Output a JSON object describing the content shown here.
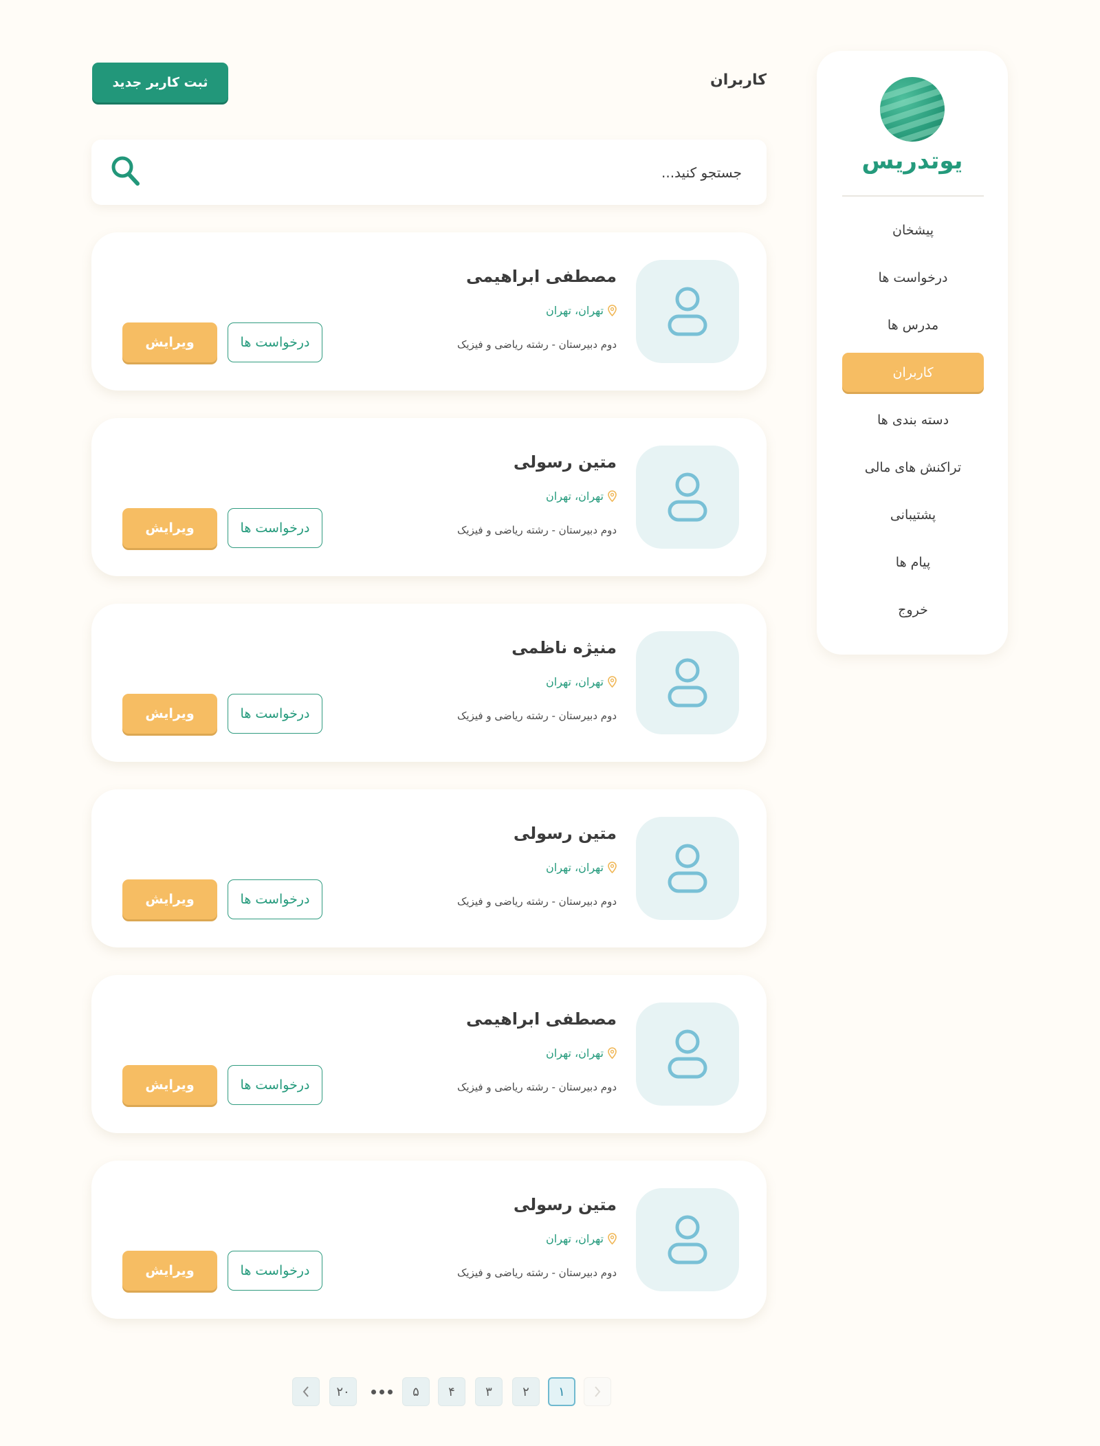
{
  "brand": {
    "name": "یوتدریس"
  },
  "sidebar": {
    "items": [
      {
        "label": "پیشخان"
      },
      {
        "label": "درخواست ها"
      },
      {
        "label": "مدرس ها"
      },
      {
        "label": "کاربران",
        "active": true
      },
      {
        "label": "دسته بندی ها"
      },
      {
        "label": "تراکنش های مالی"
      },
      {
        "label": "پشتیبانی"
      },
      {
        "label": "پیام ها"
      },
      {
        "label": "خروج"
      }
    ]
  },
  "header": {
    "title": "کاربران",
    "new_user_label": "ثبت کاربر جدید"
  },
  "search": {
    "placeholder": "جستجو کنید..."
  },
  "users": [
    {
      "name": "مصطفی ابراهیمی",
      "location": "تهران، تهران",
      "education": "دوم دبیرستان - رشته ریاضی و فیزیک"
    },
    {
      "name": "متین رسولی",
      "location": "تهران، تهران",
      "education": "دوم دبیرستان - رشته ریاضی و فیزیک"
    },
    {
      "name": "منیژه ناظمی",
      "location": "تهران، تهران",
      "education": "دوم دبیرستان - رشته ریاضی و فیزیک"
    },
    {
      "name": "متین رسولی",
      "location": "تهران، تهران",
      "education": "دوم دبیرستان - رشته ریاضی و فیزیک"
    },
    {
      "name": "مصطفی ابراهیمی",
      "location": "تهران، تهران",
      "education": "دوم دبیرستان - رشته ریاضی و فیزیک"
    },
    {
      "name": "متین رسولی",
      "location": "تهران، تهران",
      "education": "دوم دبیرستان - رشته ریاضی و فیزیک"
    }
  ],
  "card_actions": {
    "requests_label": "درخواست ها",
    "edit_label": "ویرایش"
  },
  "pagination": {
    "pages": [
      "۱",
      "۲",
      "۳",
      "۴",
      "۵"
    ],
    "last_page": "۲۰",
    "current": "۱"
  },
  "colors": {
    "primary": "#22977a",
    "accent": "#f6bd63",
    "avatar_bg": "#e7f3f4",
    "background": "#fffcf7"
  },
  "icons": {
    "search": "search-icon",
    "location": "location-pin-icon",
    "avatar": "user-icon",
    "prev": "chevron-right-icon",
    "next": "chevron-left-icon"
  }
}
